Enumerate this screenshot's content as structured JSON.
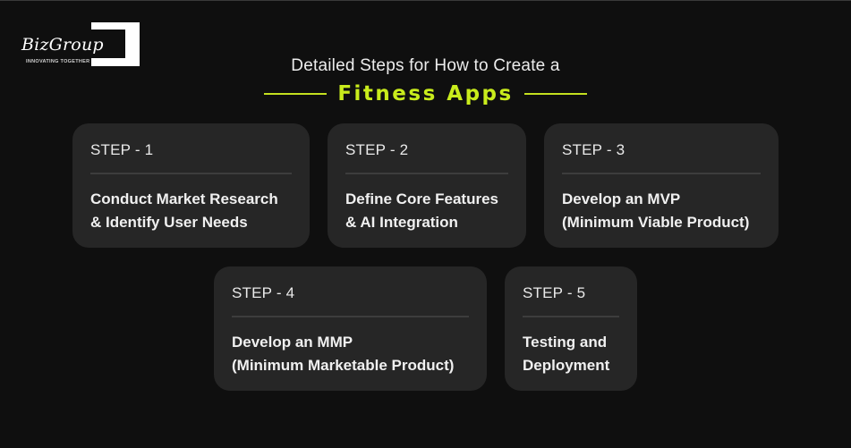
{
  "brand": {
    "name": "BizGroup",
    "tagline": "INNOVATING TOGETHER"
  },
  "header": {
    "headline": "Detailed Steps for How to Create a",
    "accent": "Fitness Apps",
    "accent_color": "#c9ec1c"
  },
  "steps": [
    {
      "label": "STEP - 1",
      "title": "Conduct Market Research\n& Identify User Needs"
    },
    {
      "label": "STEP - 2",
      "title": "Define Core Features\n& AI Integration"
    },
    {
      "label": "STEP - 3",
      "title": "Develop an MVP\n(Minimum Viable Product)"
    },
    {
      "label": "STEP - 4",
      "title": "Develop an MMP\n(Minimum Marketable Product)"
    },
    {
      "label": "STEP - 5",
      "title": "Testing and\nDeployment"
    }
  ]
}
